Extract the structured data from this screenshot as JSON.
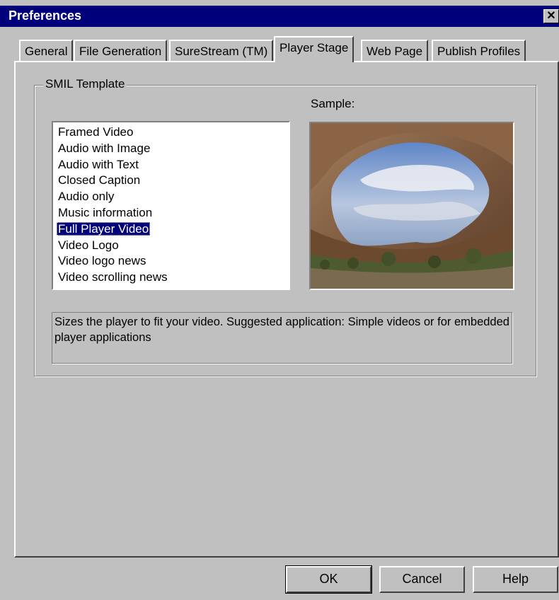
{
  "window": {
    "title": "Preferences",
    "close_glyph": "✕"
  },
  "tabs": [
    {
      "label": "General",
      "active": false
    },
    {
      "label": "File Generation",
      "active": false
    },
    {
      "label": "SureStream (TM)",
      "active": false
    },
    {
      "label": "Player Stage",
      "active": true
    },
    {
      "label": "Web Page",
      "active": false
    },
    {
      "label": "Publish Profiles",
      "active": false
    }
  ],
  "smil_template": {
    "group_label": "SMIL Template",
    "sample_label": "Sample:",
    "sample_image": "desert-rock-arch-photo",
    "items": [
      "Framed Video",
      "Audio with Image",
      "Audio with Text",
      "Closed Caption",
      "Audio only",
      "Music information",
      "Full Player Video",
      "Video Logo",
      "Video logo news",
      "Video scrolling news"
    ],
    "selected": "Full Player Video",
    "description": "Sizes the player to fit your video. Suggested application: Simple videos or for embedded player applications"
  },
  "buttons": {
    "ok": "OK",
    "cancel": "Cancel",
    "help": "Help"
  },
  "colors": {
    "title_bar": "#00007b",
    "face": "#c0c0c0",
    "selection": "#00007b"
  }
}
